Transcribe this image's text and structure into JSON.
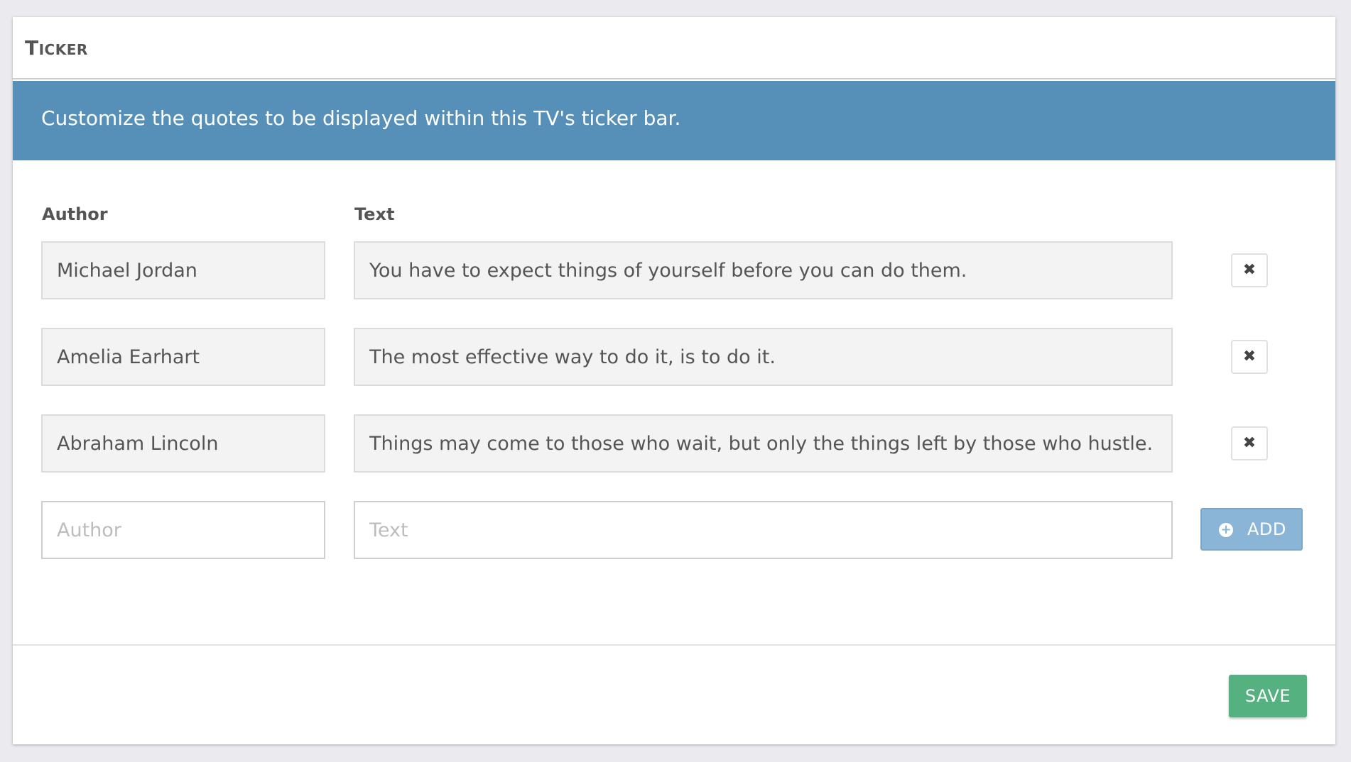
{
  "panel": {
    "title": "Ticker"
  },
  "info": {
    "text": "Customize the quotes to be displayed within this TV's ticker bar."
  },
  "columns": {
    "author": "Author",
    "text": "Text"
  },
  "quotes": [
    {
      "author": "Michael Jordan",
      "text": "You have to expect things of yourself before you can do them."
    },
    {
      "author": "Amelia Earhart",
      "text": "The most effective way to do it, is to do it."
    },
    {
      "author": "Abraham Lincoln",
      "text": "Things may come to those who wait, but only the things left by those who hustle."
    }
  ],
  "remove_icon": "✖",
  "new_quote": {
    "author_placeholder": "Author",
    "text_placeholder": "Text",
    "add_label": "ADD",
    "add_icon": "plus-circle-icon"
  },
  "footer": {
    "save_label": "SAVE"
  },
  "colors": {
    "info_bar": "#5690b9",
    "add_button": "#8ab5d6",
    "save_button": "#55b17f"
  }
}
